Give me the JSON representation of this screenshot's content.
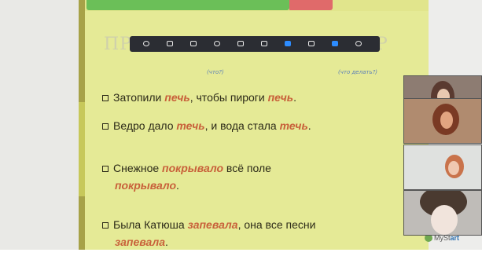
{
  "share_bar": {
    "label": "",
    "stop_label": ""
  },
  "toolbar": {
    "items": [
      {
        "label": "",
        "icon": "mute-icon"
      },
      {
        "label": "",
        "icon": "video-icon"
      },
      {
        "label": "",
        "icon": "security-icon"
      },
      {
        "label": "",
        "icon": "participants-icon"
      },
      {
        "label": "",
        "icon": "share-icon"
      },
      {
        "label": "",
        "icon": "pause-icon"
      },
      {
        "label": "",
        "icon": "annotate-icon"
      },
      {
        "label": "",
        "icon": "control-icon"
      },
      {
        "label": "",
        "icon": "chat-icon"
      },
      {
        "label": "",
        "icon": "record-icon"
      },
      {
        "label": "",
        "icon": "more-icon"
      }
    ]
  },
  "slide": {
    "title_start": "ПР",
    "title_end": "Р",
    "hint_left": "(что?)",
    "hint_right": "(что делать?)",
    "lines": [
      {
        "pre": "Затопили ",
        "hl1": "печь",
        "mid": ", чтобы пироги ",
        "hl2": "печь",
        "post": "."
      },
      {
        "pre": "Ведро дало ",
        "hl1": "течь",
        "mid": ", и вода стала ",
        "hl2": "течь",
        "post": "."
      },
      {
        "pre": "Снежное ",
        "hl1": "покрывало",
        "mid": " всё поле",
        "hl2": "покрывало",
        "post": "."
      },
      {
        "pre": "Была Катюша ",
        "hl1": "запевала",
        "mid": ", она все песни",
        "hl2": "запевала",
        "post": "."
      }
    ],
    "logo_prefix": "MySt",
    "logo_suffix": "art"
  },
  "participants": [
    {
      "name": "",
      "icon": "video-tile"
    },
    {
      "name": "",
      "icon": "video-tile"
    },
    {
      "name": "",
      "icon": "video-tile"
    },
    {
      "name": "",
      "icon": "video-tile"
    }
  ],
  "colors": {
    "slide_bg": "#e5ea96",
    "highlight": "#c8603a",
    "toolbar_bg": "#2b2d33",
    "share_green": "#6bbf58",
    "stop_red": "#e06a6a"
  }
}
